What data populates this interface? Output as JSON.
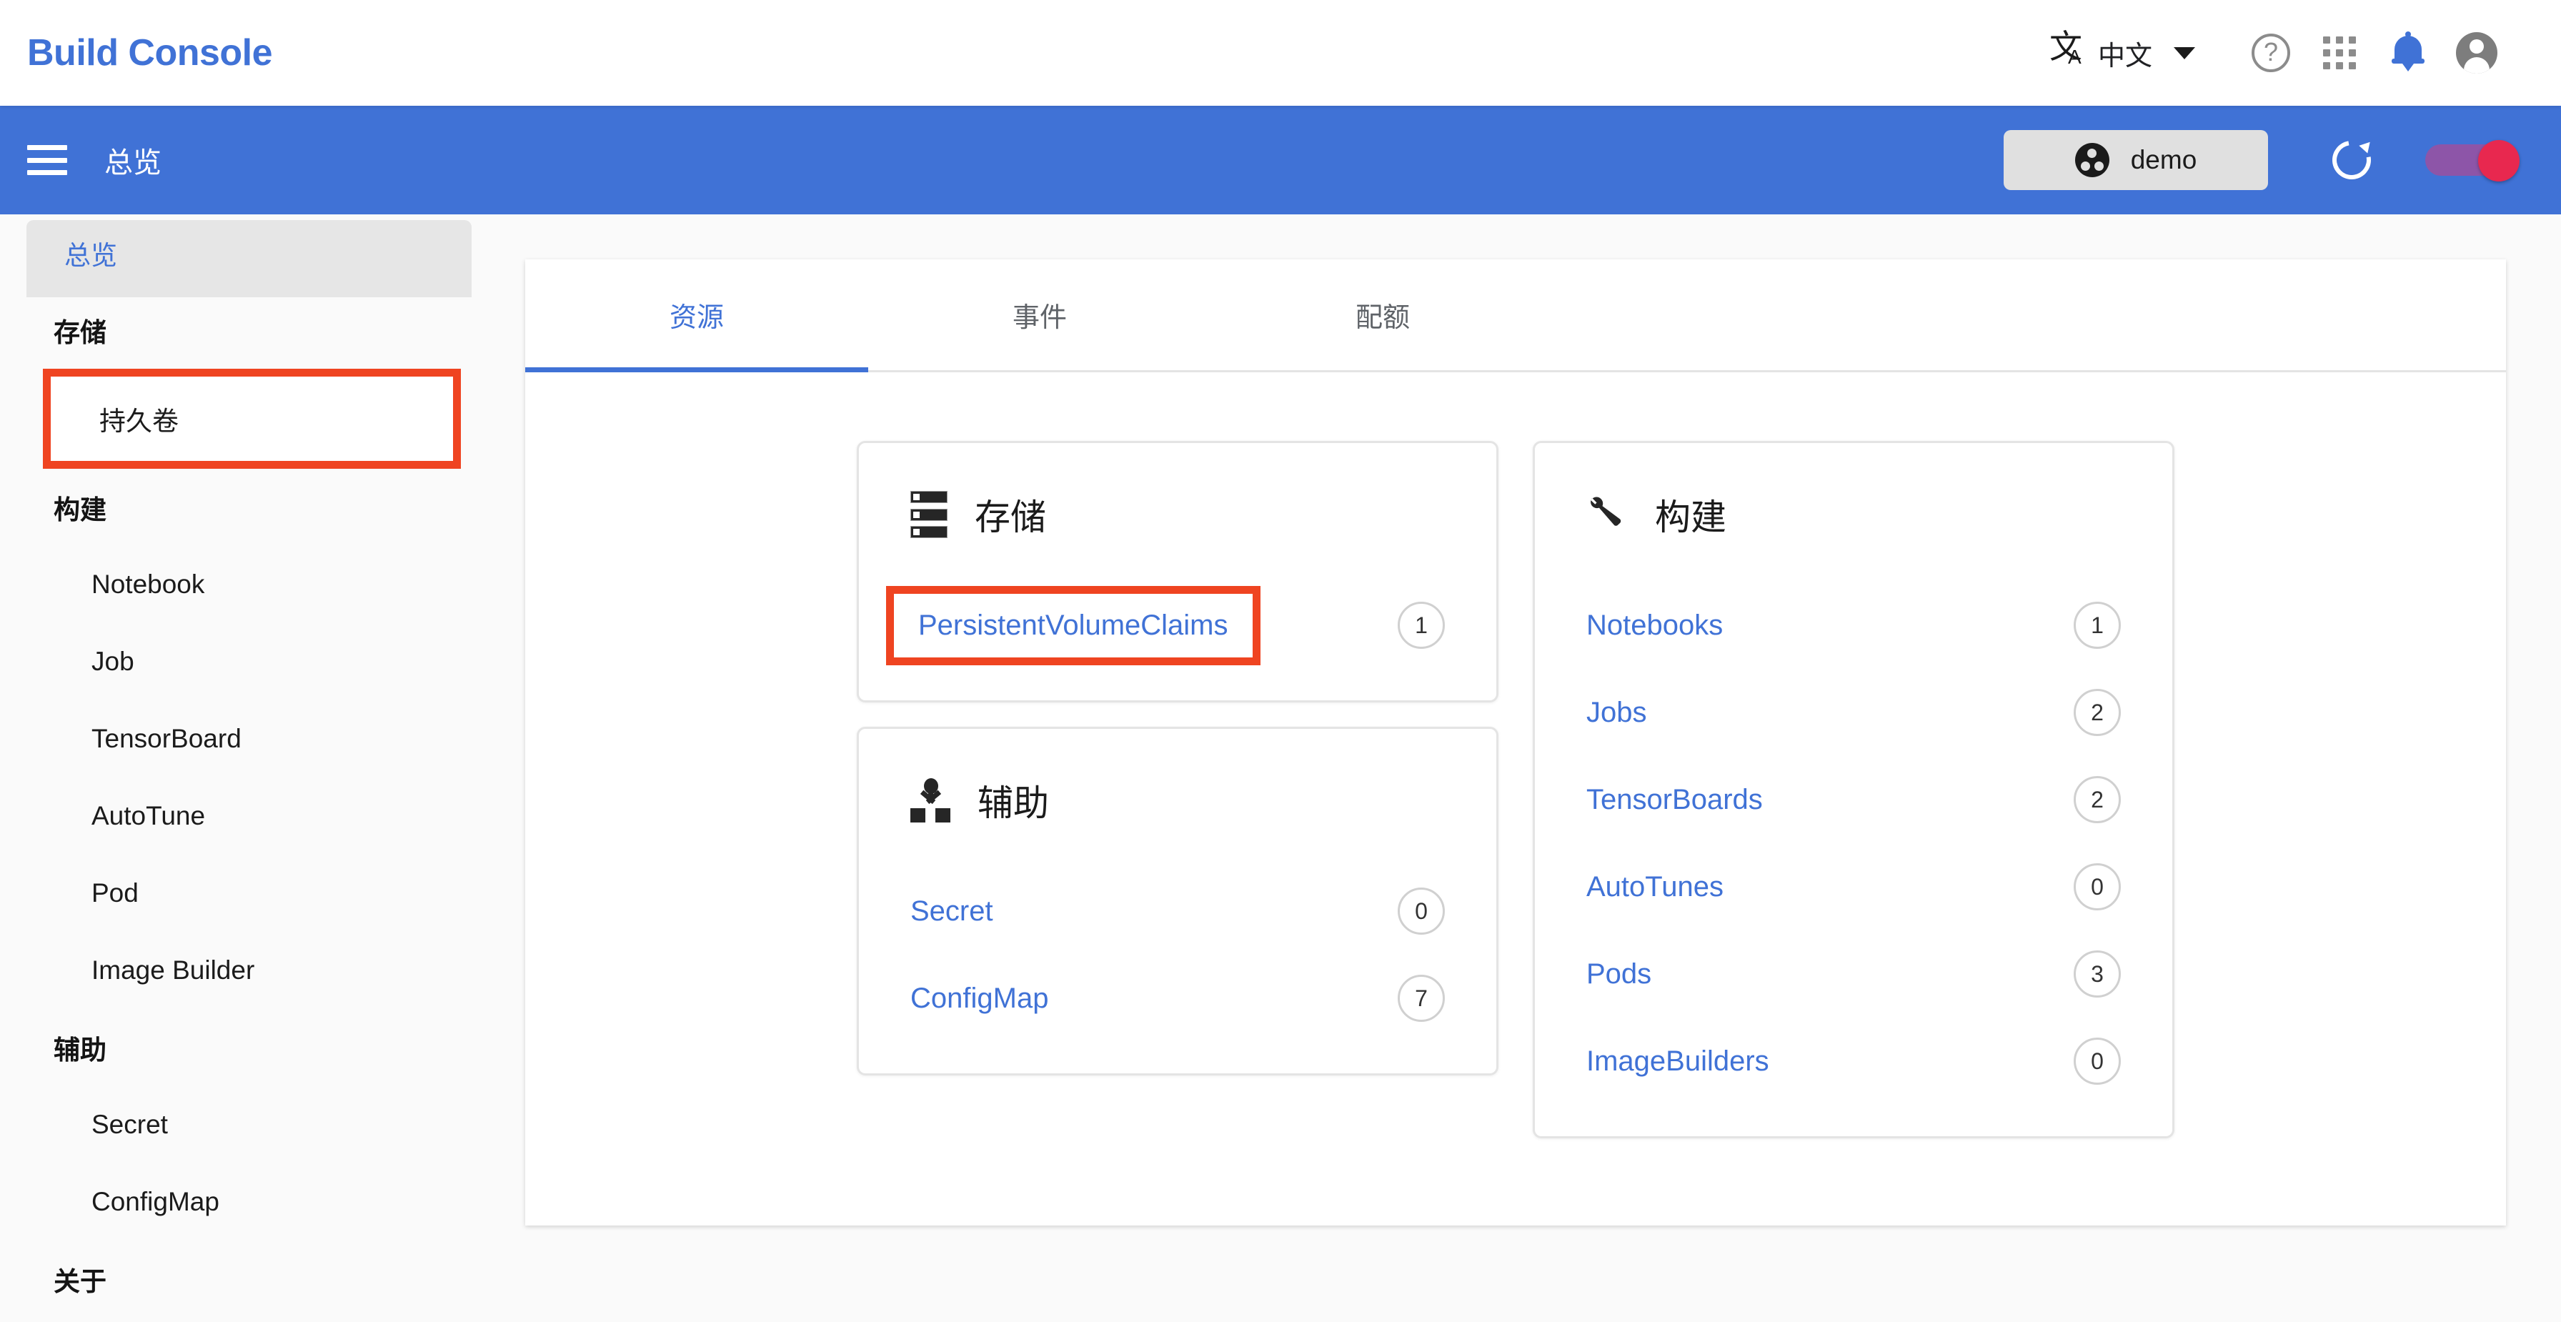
{
  "appbar": {
    "brand": "Build Console",
    "language_label": "中文",
    "icons": {
      "translate_big": "文",
      "translate_small": "A",
      "help": "?"
    }
  },
  "toolbar": {
    "title": "总览",
    "namespace_chip": "demo"
  },
  "sidebar": {
    "items": [
      {
        "label": "总览",
        "type": "selected"
      },
      {
        "label": "存储",
        "type": "group"
      },
      {
        "label": "持久卷",
        "type": "child",
        "highlighted": true
      },
      {
        "label": "构建",
        "type": "group"
      },
      {
        "label": "Notebook",
        "type": "child"
      },
      {
        "label": "Job",
        "type": "child"
      },
      {
        "label": "TensorBoard",
        "type": "child"
      },
      {
        "label": "AutoTune",
        "type": "child"
      },
      {
        "label": "Pod",
        "type": "child"
      },
      {
        "label": "Image Builder",
        "type": "child"
      },
      {
        "label": "辅助",
        "type": "group"
      },
      {
        "label": "Secret",
        "type": "child"
      },
      {
        "label": "ConfigMap",
        "type": "child"
      },
      {
        "label": "关于",
        "type": "group"
      }
    ]
  },
  "main": {
    "tabs": [
      {
        "label": "资源",
        "active": true
      },
      {
        "label": "事件",
        "active": false
      },
      {
        "label": "配额",
        "active": false
      }
    ],
    "cards": [
      {
        "id": "storage",
        "title": "存储",
        "icon": "storage-stack-icon",
        "rows": [
          {
            "label": "PersistentVolumeClaims",
            "count": "1",
            "highlighted": true
          }
        ]
      },
      {
        "id": "auxiliary",
        "title": "辅助",
        "icon": "device-hub-icon",
        "rows": [
          {
            "label": "Secret",
            "count": "0"
          },
          {
            "label": "ConfigMap",
            "count": "7"
          }
        ]
      },
      {
        "id": "build",
        "title": "构建",
        "icon": "wrench-icon",
        "rows": [
          {
            "label": "Notebooks",
            "count": "1"
          },
          {
            "label": "Jobs",
            "count": "2"
          },
          {
            "label": "TensorBoards",
            "count": "2"
          },
          {
            "label": "AutoTunes",
            "count": "0"
          },
          {
            "label": "Pods",
            "count": "3"
          },
          {
            "label": "ImageBuilders",
            "count": "0"
          }
        ]
      }
    ]
  },
  "colors": {
    "brand_blue": "#4072d6",
    "link_blue": "#4072d6",
    "highlight_red": "#ef4421",
    "toggle_thumb": "#e8284f",
    "toggle_track": "#8d55a8"
  }
}
